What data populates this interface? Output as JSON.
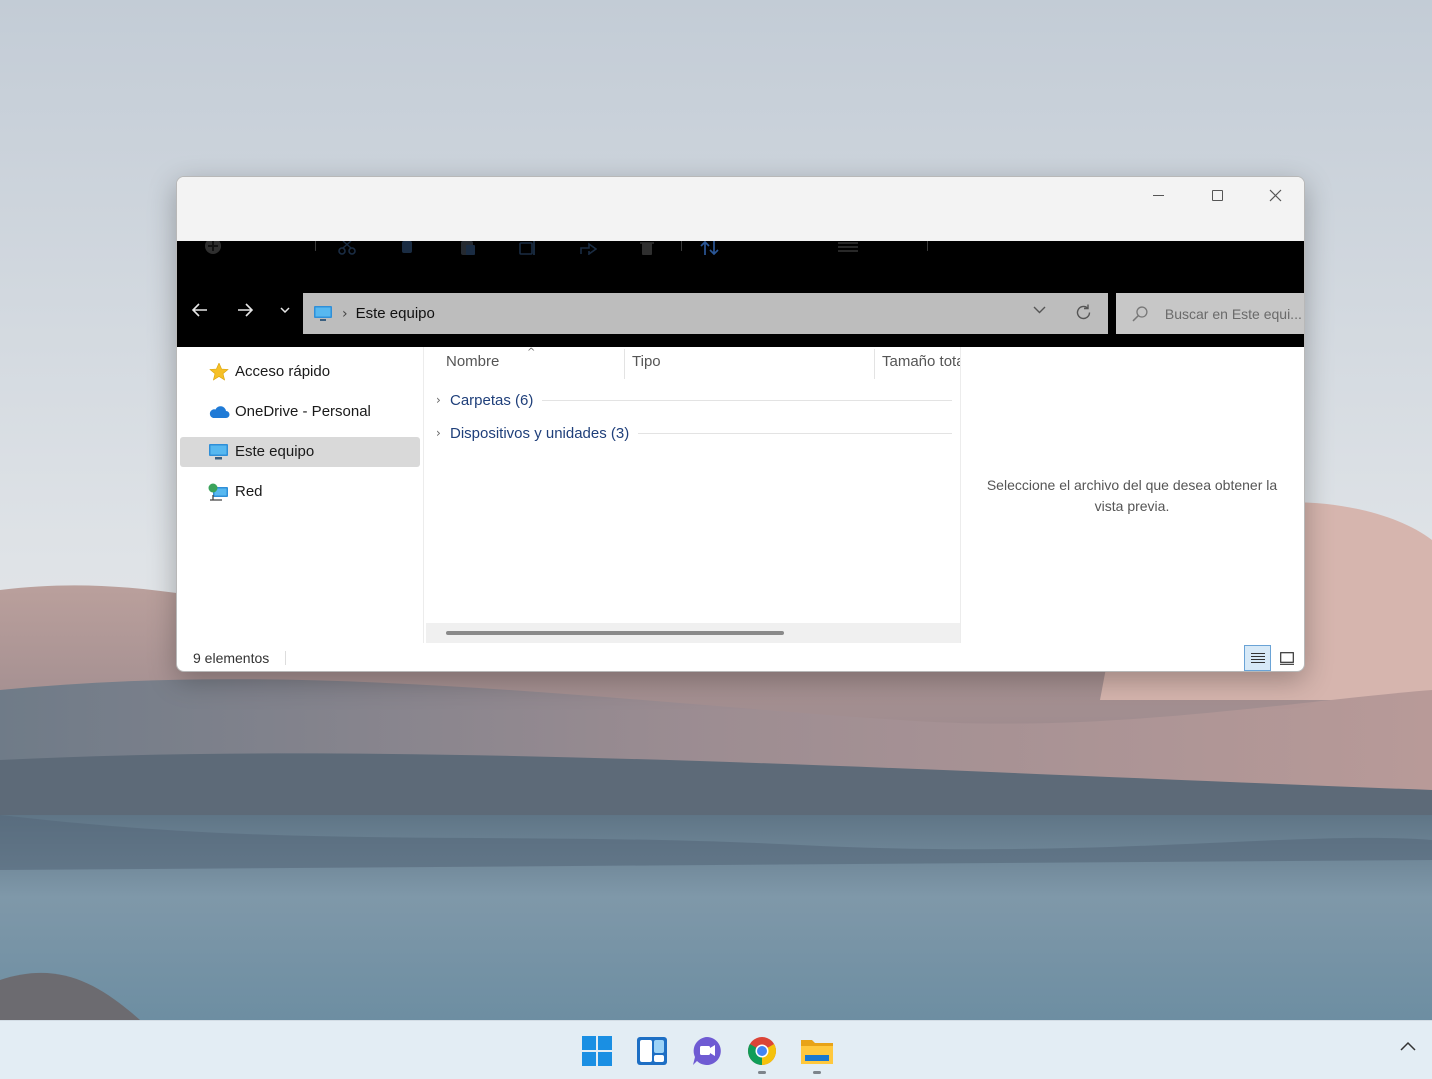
{
  "window": {
    "address_crumb": "Este equipo",
    "search_placeholder": "Buscar en Este equi...",
    "controls": {
      "minimize": "minimize-icon",
      "maximize": "maximize-icon",
      "close": "close-icon"
    }
  },
  "toolbar": {
    "icons": [
      "new-icon",
      "cut-icon",
      "copy-icon",
      "paste-icon",
      "rename-icon",
      "share-icon",
      "delete-icon",
      "sort-icon",
      "view-icon"
    ]
  },
  "sidebar": {
    "items": [
      {
        "label": "Acceso rápido",
        "icon": "star-icon"
      },
      {
        "label": "OneDrive - Personal",
        "icon": "cloud-icon"
      },
      {
        "label": "Este equipo",
        "icon": "computer-icon",
        "selected": true
      },
      {
        "label": "Red",
        "icon": "network-icon"
      }
    ]
  },
  "content": {
    "columns": [
      "Nombre",
      "Tipo",
      "Tamaño total"
    ],
    "groups": [
      {
        "label": "Carpetas (6)"
      },
      {
        "label": "Dispositivos y unidades (3)"
      }
    ]
  },
  "preview": {
    "message": "Seleccione el archivo del que desea obtener la vista previa."
  },
  "status": {
    "count": "9 elementos"
  },
  "taskbar": {
    "apps": [
      "start-icon",
      "widgets-icon",
      "chat-icon",
      "chrome-icon",
      "file-explorer-icon"
    ]
  },
  "colors": {
    "accent": "#0067c0",
    "group_text": "#1f3f7a",
    "selected_bg": "#d9d9d9",
    "chrome_dark": "#000000",
    "address_bg": "#bdbdbd"
  }
}
